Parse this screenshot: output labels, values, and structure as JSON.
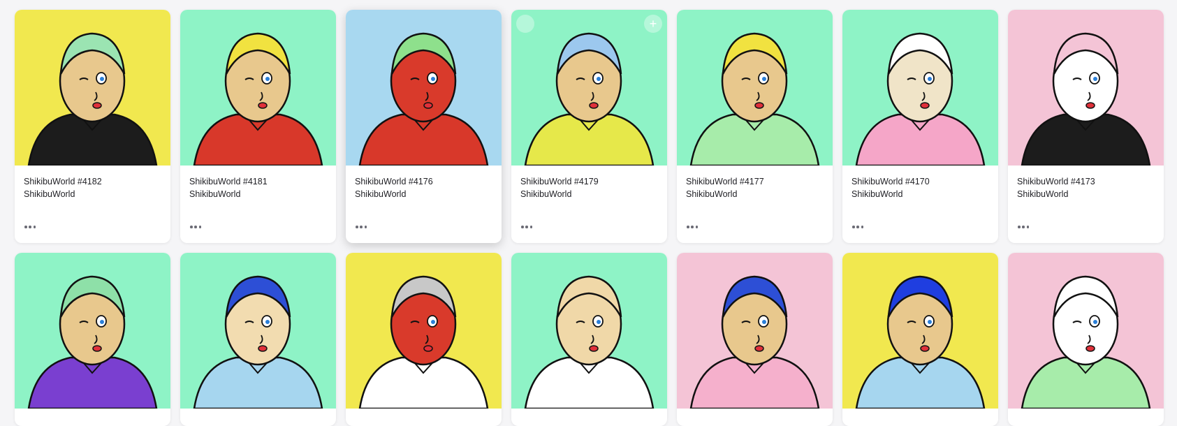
{
  "colors": {
    "mint": "#8ef3c6",
    "yellow": "#f1e84f",
    "pink": "#f4c4d6",
    "skin": "#e8c88d",
    "red_skin": "#d93a2b",
    "outline": "#111111"
  },
  "more_icon": "ellipsis-icon",
  "row1": [
    {
      "name": "ShikibuWorld #4182",
      "collection": "ShikibuWorld",
      "bg": "#f1e84f",
      "face": "#e8c88d",
      "hair": "#9be4b2",
      "body": "#1c1c1c"
    },
    {
      "name": "ShikibuWorld #4181",
      "collection": "ShikibuWorld",
      "bg": "#8ef3c6",
      "face": "#e8c88d",
      "hair": "#f1e240",
      "body": "#d8382a"
    },
    {
      "name": "ShikibuWorld #4176",
      "collection": "ShikibuWorld",
      "bg": "#a8d8f0",
      "face": "#d93a2b",
      "hair": "#8ee08c",
      "body": "#d8382a"
    },
    {
      "name": "ShikibuWorld #4179",
      "collection": "ShikibuWorld",
      "bg": "#8ef3c6",
      "face": "#e8c88d",
      "hair": "#9cc8ee",
      "body": "#e6e84a"
    },
    {
      "name": "ShikibuWorld #4177",
      "collection": "ShikibuWorld",
      "bg": "#8ef3c6",
      "face": "#e8c88d",
      "hair": "#f1e240",
      "body": "#a7ecaa"
    },
    {
      "name": "ShikibuWorld #4170",
      "collection": "ShikibuWorld",
      "bg": "#8ef3c6",
      "face": "#f0e4c8",
      "hair": "#ffffff",
      "body": "#f5a6c8"
    },
    {
      "name": "ShikibuWorld #4173",
      "collection": "ShikibuWorld",
      "bg": "#f4c4d6",
      "face": "#ffffff",
      "hair": "#f4c4d6",
      "body": "#1c1c1c"
    }
  ],
  "row2": [
    {
      "bg": "#8ef3c6",
      "face": "#e8c88d",
      "hair": "#8ee0a8",
      "body": "#7a3fd0"
    },
    {
      "bg": "#8ef3c6",
      "face": "#f2dcb0",
      "hair": "#2d4fd6",
      "body": "#a6d6ef"
    },
    {
      "bg": "#f1e84f",
      "face": "#d93a2b",
      "hair": "#c8c8c8",
      "body": "#ffffff"
    },
    {
      "bg": "#8ef3c6",
      "face": "#f0d8a8",
      "hair": "#f0d8a8",
      "body": "#ffffff"
    },
    {
      "bg": "#f4c4d6",
      "face": "#e8c88d",
      "hair": "#2d4fd6",
      "body": "#f5b0cc"
    },
    {
      "bg": "#f1e84f",
      "face": "#e8c88d",
      "hair": "#1f3ee0",
      "body": "#a6d6ef"
    },
    {
      "bg": "#f4c4d6",
      "face": "#ffffff",
      "hair": "#ffffff",
      "body": "#a7ecaa"
    }
  ]
}
